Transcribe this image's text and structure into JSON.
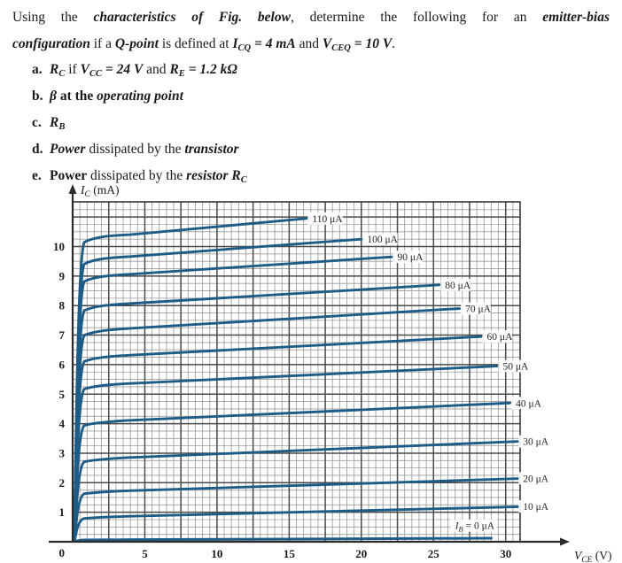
{
  "problem": {
    "intro_part1": "Using the ",
    "intro_em1": "characteristics of Fig. below",
    "intro_part2": ", determine the following for an ",
    "intro_em2": "emitter-bias",
    "line2_em1": "configuration",
    "line2_part1": " if a ",
    "line2_em2": "Q-point",
    "line2_part2": " is defined at ",
    "line2_em3": "I",
    "line2_em3_sub": "CQ",
    "line2_em4": " = 4 mA",
    "line2_part3": " and ",
    "line2_em5": "V",
    "line2_em5_sub": "CEQ",
    "line2_em6": " = 10 V",
    "line2_end": ".",
    "items": [
      {
        "marker": "a.",
        "text": "R_C if V_CC = 24 V and R_E = 1.2 kΩ"
      },
      {
        "marker": "b.",
        "text": "β at the operating point"
      },
      {
        "marker": "c.",
        "text": "R_B"
      },
      {
        "marker": "d.",
        "text": "Power dissipated by the transistor"
      },
      {
        "marker": "e.",
        "text": "Power dissipated by the resistor R_C"
      }
    ]
  },
  "chart_data": {
    "type": "line",
    "title": "",
    "xlabel": "V_CE (V)",
    "ylabel": "I_C (mA)",
    "ylabel_main": "I",
    "ylabel_sub": "C",
    "ylabel_unit": "(mA)",
    "xlabel_main": "V",
    "xlabel_sub": "CE",
    "xlabel_unit": "(V)",
    "xlim": [
      0,
      32
    ],
    "ylim": [
      0,
      11.5
    ],
    "xticks": [
      0,
      5,
      10,
      15,
      20,
      25,
      30
    ],
    "xtick_labels": [
      "0",
      "5",
      "10",
      "15",
      "20",
      "25",
      "30"
    ],
    "yticks": [
      1,
      2,
      3,
      4,
      5,
      6,
      7,
      8,
      9,
      10
    ],
    "ytick_labels": [
      "1",
      "2",
      "3",
      "4",
      "5",
      "6",
      "7",
      "8",
      "9",
      "10"
    ],
    "grid": true,
    "grid_minor_step_x": 0.5,
    "grid_minor_step_y": 0.25,
    "grid_major_step_x": 2.5,
    "grid_major_step_y": 1,
    "legend_position": "inline-right-of-curve",
    "curve_color": "#1d5c86",
    "grid_color": "#8c8c8c",
    "axis_color": "#2b2b2b",
    "series": [
      {
        "name": "110 uA",
        "label": "110 μA",
        "ib_ua": 110,
        "ic_knee": 10.3,
        "ic_end": 10.95,
        "x_end": 16.2,
        "label_x": 16.6,
        "label_y": 10.95
      },
      {
        "name": "100 uA",
        "label": "100 μA",
        "ib_ua": 100,
        "ic_knee": 9.55,
        "ic_end": 10.25,
        "x_end": 20.0,
        "label_x": 20.4,
        "label_y": 10.25
      },
      {
        "name": "90 uA",
        "label": "90 μA",
        "ib_ua": 90,
        "ic_knee": 8.95,
        "ic_end": 9.65,
        "x_end": 22.1,
        "label_x": 22.5,
        "label_y": 9.65
      },
      {
        "name": "80 uA",
        "label": "80 μA",
        "ib_ua": 80,
        "ic_knee": 7.95,
        "ic_end": 8.7,
        "x_end": 25.4,
        "label_x": 25.8,
        "label_y": 8.7
      },
      {
        "name": "70 uA",
        "label": "70 μA",
        "ib_ua": 70,
        "ic_knee": 7.1,
        "ic_end": 7.9,
        "x_end": 26.8,
        "label_x": 27.2,
        "label_y": 7.9
      },
      {
        "name": "60 uA",
        "label": "60 μA",
        "ib_ua": 60,
        "ic_knee": 6.2,
        "ic_end": 6.95,
        "x_end": 28.3,
        "label_x": 28.7,
        "label_y": 6.95
      },
      {
        "name": "50 uA",
        "label": "50 μA",
        "ib_ua": 50,
        "ic_knee": 5.25,
        "ic_end": 5.95,
        "x_end": 29.4,
        "label_x": 29.8,
        "label_y": 5.95
      },
      {
        "name": "40 uA",
        "label": "40 μA",
        "ib_ua": 40,
        "ic_knee": 4.0,
        "ic_end": 4.7,
        "x_end": 30.3,
        "label_x": 30.7,
        "label_y": 4.7
      },
      {
        "name": "30 uA",
        "label": "30 μA",
        "ib_ua": 30,
        "ic_knee": 2.75,
        "ic_end": 3.4,
        "x_end": 31.0,
        "label_x": 31.4,
        "label_y": 3.4
      },
      {
        "name": "20 uA",
        "label": "20 μA",
        "ib_ua": 20,
        "ic_knee": 1.65,
        "ic_end": 2.15,
        "x_end": 31.6,
        "label_x": 32.0,
        "label_y": 2.15
      },
      {
        "name": "10 uA",
        "label": "10 μA",
        "ib_ua": 10,
        "ic_knee": 0.8,
        "ic_end": 1.2,
        "x_end": 32.2,
        "label_x": 32.6,
        "label_y": 1.2
      },
      {
        "name": "0 uA",
        "label": "I_B = 0 μA",
        "ib_ua": 0,
        "ic_knee": 0.06,
        "ic_end": 0.12,
        "x_end": 29.0,
        "label_x": 26.5,
        "label_y": 0.55
      }
    ],
    "zero_curve_label": {
      "main": "I",
      "sub": "B",
      "rest": " = 0 μA"
    }
  }
}
